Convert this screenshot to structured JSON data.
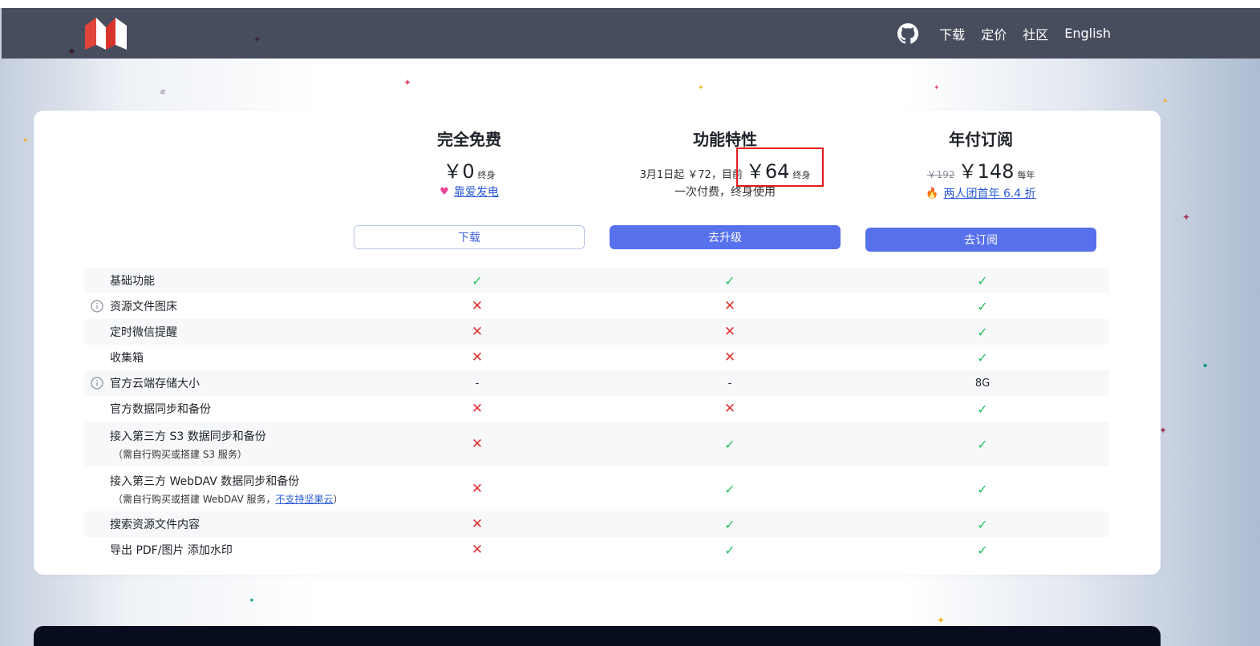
{
  "nav": {
    "logo_icon": "m-brand-logo-icon",
    "github_icon": "github-icon",
    "links": [
      "下载",
      "定价",
      "社区",
      "English"
    ]
  },
  "plans": [
    {
      "title": "完全免费",
      "price": "￥0",
      "unit": "终身",
      "sub_icon": "heart-icon",
      "sub_text": "靠爱发电",
      "button": "下载"
    },
    {
      "title": "功能特性",
      "price_prefix": "3月1日起 ￥72，目前",
      "price": "￥64",
      "unit": "终身",
      "sub_text": "一次付费，终身使用",
      "button": "去升级"
    },
    {
      "title": "年付订阅",
      "price_original": "￥192",
      "price": "￥148",
      "unit": "每年",
      "sub_icon": "fire-icon",
      "sub_text": "两人团首年 6.4 折",
      "button": "去订阅"
    }
  ],
  "features": [
    {
      "name": "基础功能",
      "values": [
        "check",
        "check",
        "check"
      ]
    },
    {
      "name": "资源文件图床",
      "info": true,
      "values": [
        "cross",
        "cross",
        "check"
      ]
    },
    {
      "name": "定时微信提醒",
      "values": [
        "cross",
        "cross",
        "check"
      ]
    },
    {
      "name": "收集箱",
      "values": [
        "cross",
        "cross",
        "check"
      ]
    },
    {
      "name": "官方云端存储大小",
      "info": true,
      "values": [
        "-",
        "-",
        "8G"
      ]
    },
    {
      "name": "官方数据同步和备份",
      "values": [
        "cross",
        "cross",
        "check"
      ]
    },
    {
      "name": "接入第三方 S3 数据同步和备份",
      "note": "（需自行购买或搭建 S3 服务）",
      "values": [
        "cross",
        "check",
        "check"
      ]
    },
    {
      "name": "接入第三方 WebDAV 数据同步和备份",
      "note": "（需自行购买或搭建 WebDAV 服务，",
      "note_link": "不支持坚果云",
      "note_end": "）",
      "values": [
        "cross",
        "check",
        "check"
      ]
    },
    {
      "name": "搜索资源文件内容",
      "values": [
        "cross",
        "check",
        "check"
      ]
    },
    {
      "name": "导出 PDF/图片 添加水印",
      "values": [
        "cross",
        "check",
        "check"
      ]
    }
  ],
  "colors": {
    "navbar": "#474d5d",
    "accent_button": "#5771ec",
    "check": "#22c55e",
    "cross": "#e03131",
    "highlight_box": "#e31b1b"
  }
}
